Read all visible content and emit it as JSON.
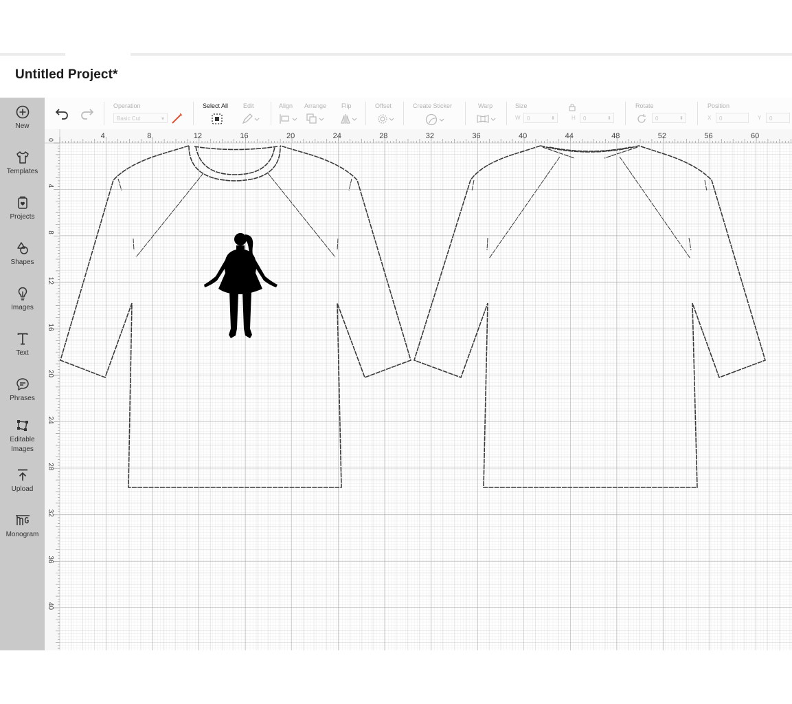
{
  "app": {
    "title": "Untitled Project*"
  },
  "sidebar": {
    "items": [
      {
        "label": "New",
        "icon": "plus-circle-icon"
      },
      {
        "label": "Templates",
        "icon": "tshirt-icon"
      },
      {
        "label": "Projects",
        "icon": "projects-icon"
      },
      {
        "label": "Shapes",
        "icon": "shapes-icon"
      },
      {
        "label": "Images",
        "icon": "lightbulb-icon"
      },
      {
        "label": "Text",
        "icon": "text-icon"
      },
      {
        "label": "Phrases",
        "icon": "speech-bubble-icon"
      },
      {
        "label": "Editable\nImages",
        "icon": "editable-images-icon"
      },
      {
        "label": "Upload",
        "icon": "upload-icon"
      },
      {
        "label": "Monogram",
        "icon": "monogram-icon"
      }
    ]
  },
  "toolbar": {
    "operation_label": "Operation",
    "operation_value": "Basic Cut",
    "select_all_label": "Select All",
    "edit_label": "Edit",
    "align_label": "Align",
    "arrange_label": "Arrange",
    "flip_label": "Flip",
    "offset_label": "Offset",
    "create_sticker_label": "Create Sticker",
    "warp_label": "Warp",
    "size_label": "Size",
    "size_w_label": "W",
    "size_w_value": "0",
    "size_h_label": "H",
    "size_h_value": "0",
    "rotate_label": "Rotate",
    "rotate_value": "0",
    "position_label": "Position",
    "position_x_label": "X",
    "position_x_value": "0",
    "position_y_label": "Y",
    "position_y_value": "0"
  },
  "ruler": {
    "top_labels": [
      "0",
      "4",
      "8",
      "12",
      "16",
      "20",
      "24",
      "28",
      "32",
      "36",
      "40",
      "44",
      "48",
      "52",
      "56",
      "60"
    ],
    "left_labels": [
      "0",
      "4",
      "8",
      "12",
      "16",
      "20",
      "24",
      "28",
      "32",
      "36",
      "40"
    ]
  },
  "colors": {
    "sidebar_bg": "#c9c9c9",
    "grid_minor": "#dcdcdc",
    "grid_major": "#b8b8b8",
    "outline": "#444444",
    "operation_swatch": "#e0502f"
  }
}
